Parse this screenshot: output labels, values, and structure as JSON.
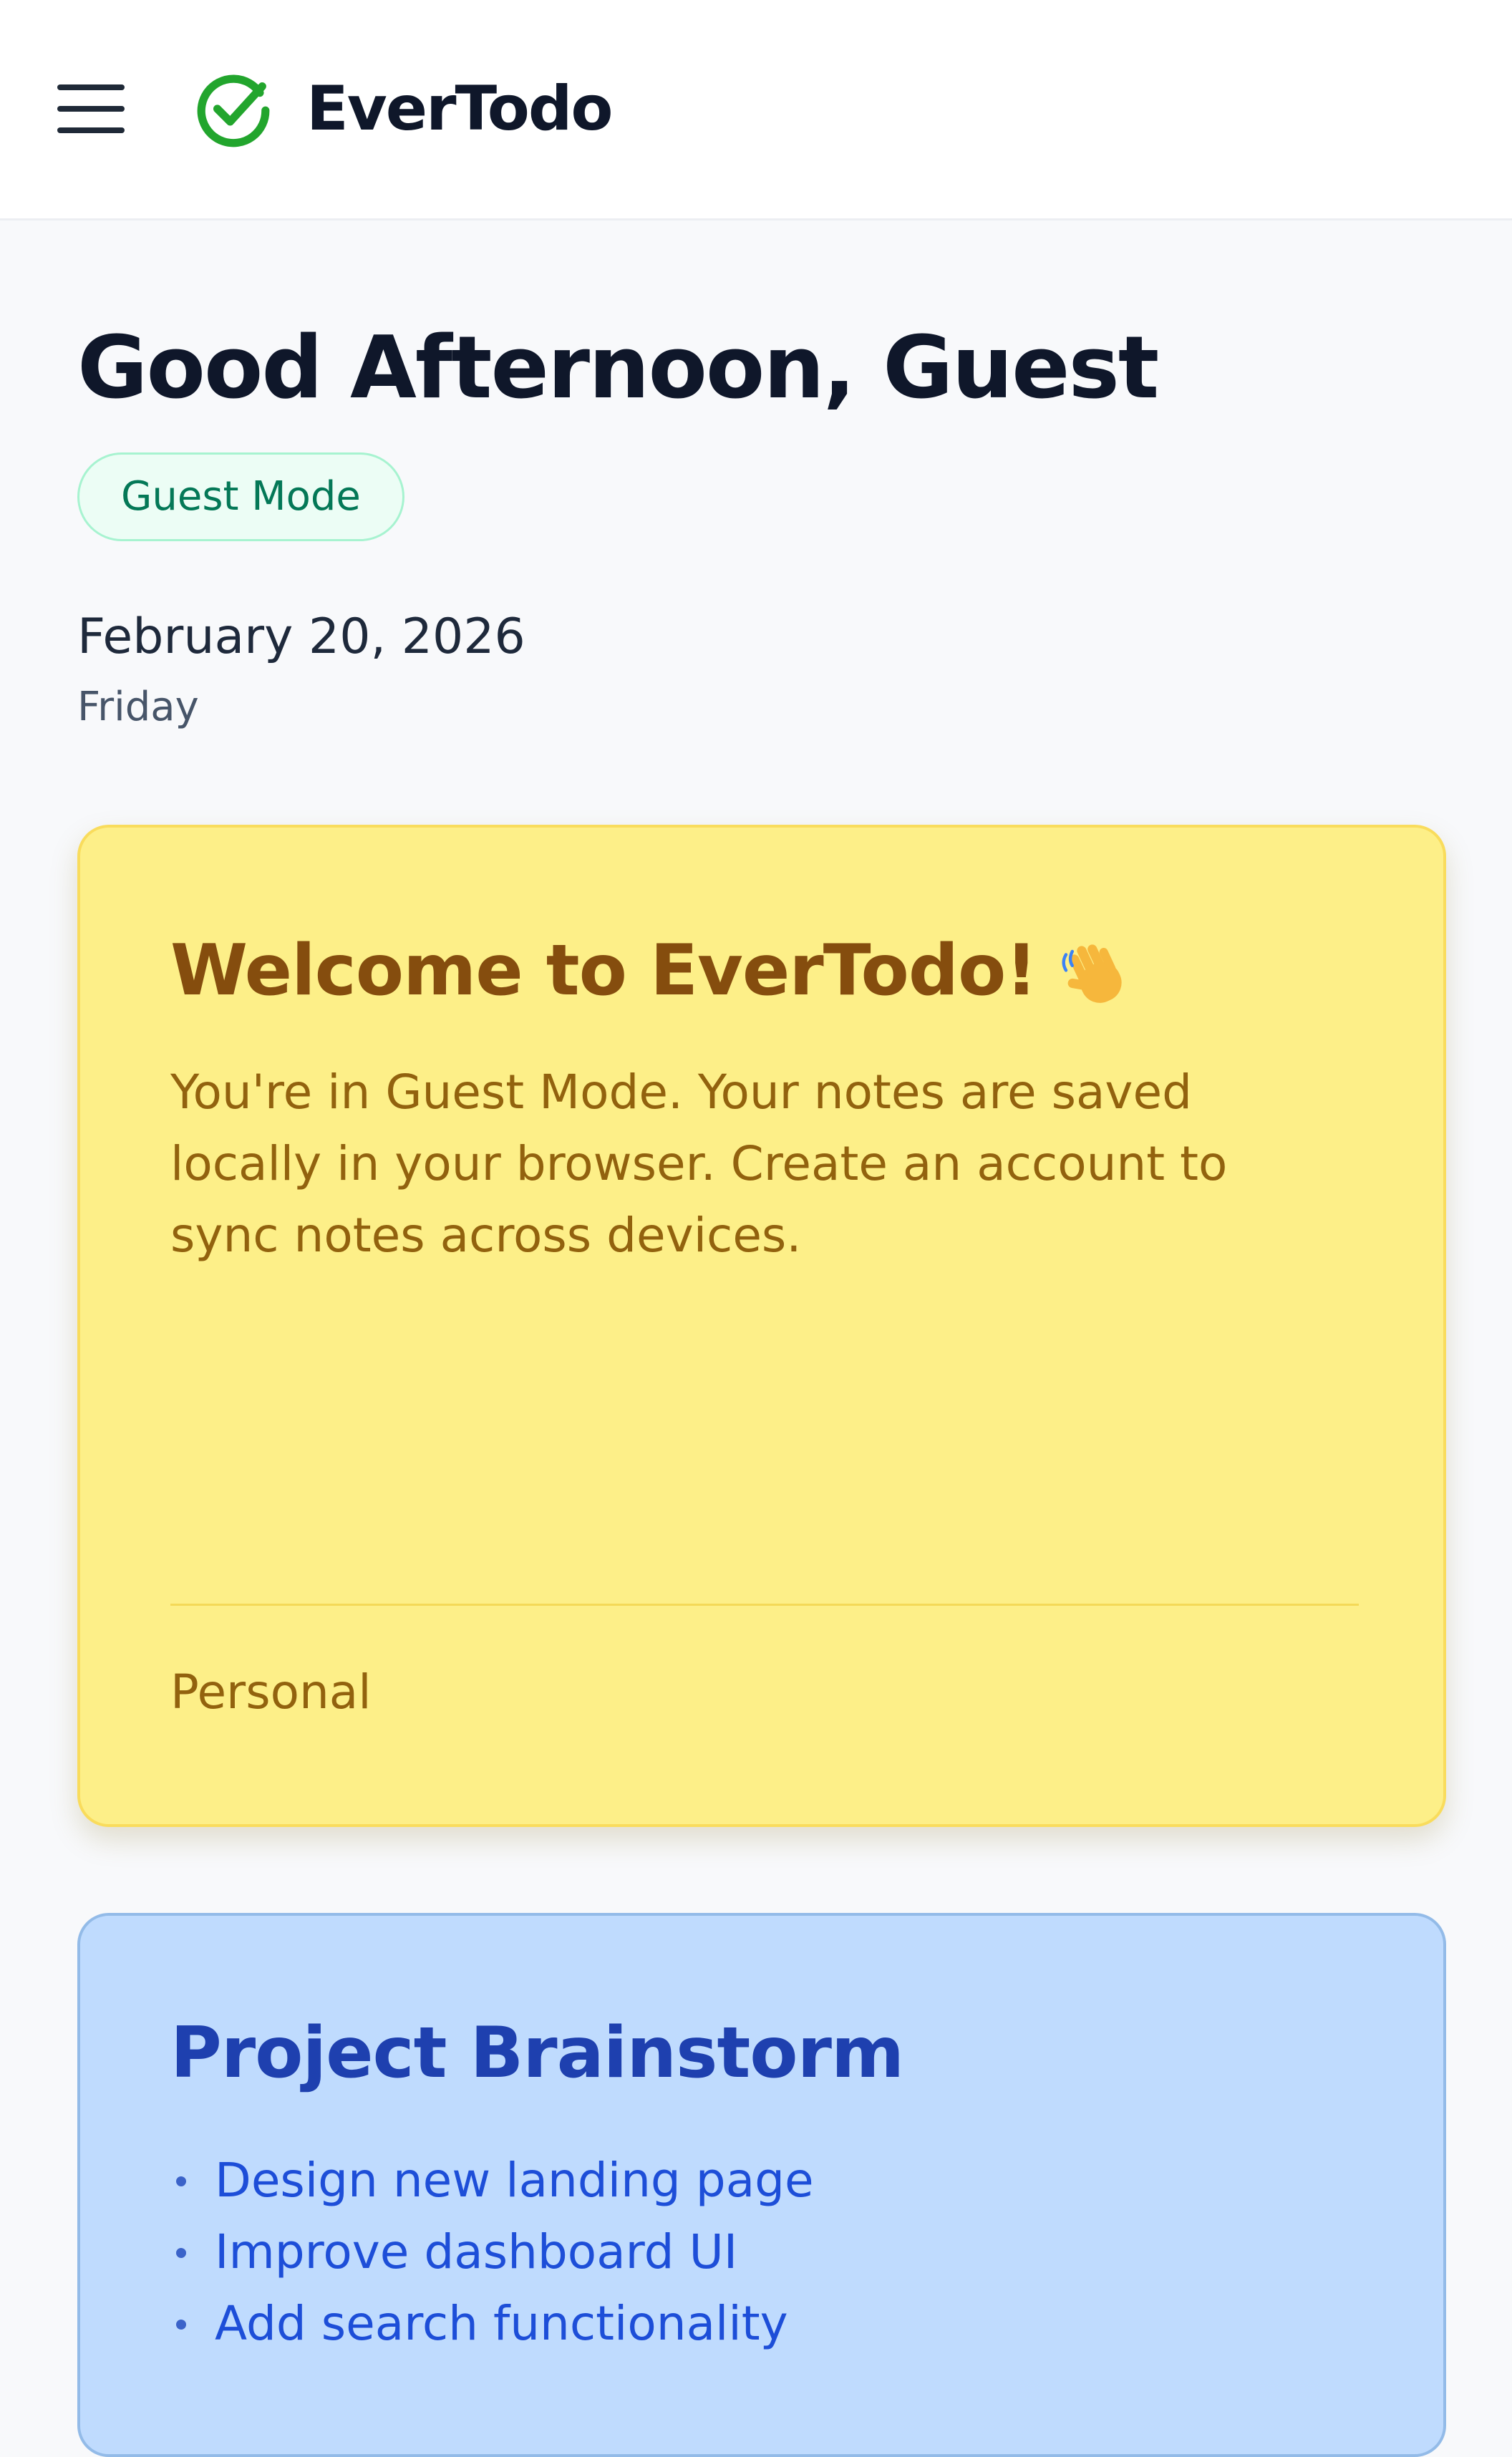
{
  "header": {
    "menu_icon": "hamburger-menu-icon",
    "logo_icon": "check-circle-icon",
    "brand_name": "EverTodo",
    "brand_color": "#22a52d"
  },
  "dashboard": {
    "greeting": "Good Afternoon, Guest",
    "mode_badge": "Guest Mode",
    "date": "February 20, 2026",
    "weekday": "Friday"
  },
  "notes": [
    {
      "title": "Welcome to EverTodo!",
      "title_icon": "waving-hand-icon",
      "body": "You're in Guest Mode. Your notes are saved locally in your browser. Create an account to sync notes across devices.",
      "tag": "Personal",
      "color": "#fdef88"
    },
    {
      "title": "Project Brainstorm",
      "items": [
        "Design new landing page",
        "Improve dashboard UI",
        "Add search functionality"
      ],
      "color": "#bfdbfe"
    }
  ]
}
